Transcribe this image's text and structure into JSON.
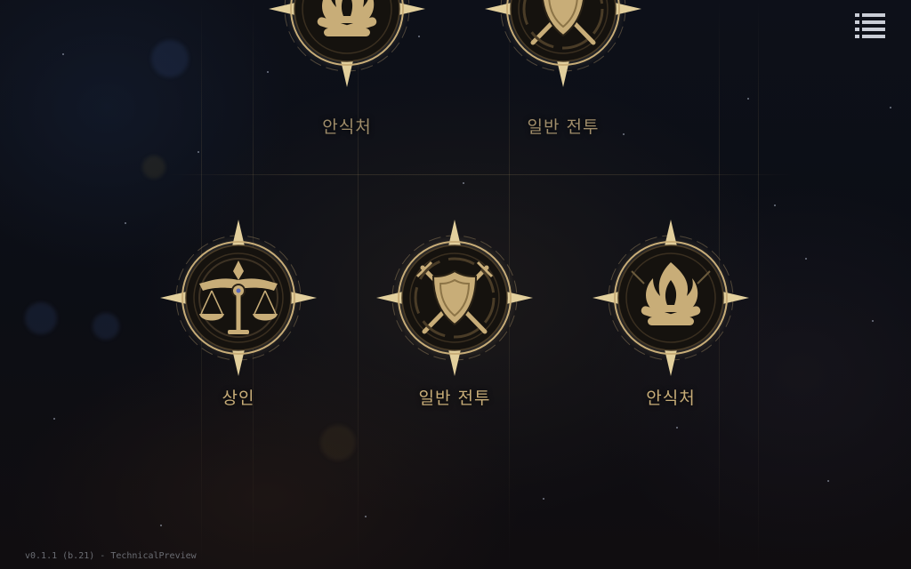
{
  "map": {
    "nodes": [
      {
        "id": "top-rest",
        "label": "안식처",
        "icon": "campfire-icon"
      },
      {
        "id": "top-battle",
        "label": "일반 전투",
        "icon": "crossed-swords-shield-icon"
      },
      {
        "id": "merchant",
        "label": "상인",
        "icon": "scales-icon"
      },
      {
        "id": "battle",
        "label": "일반 전투",
        "icon": "crossed-swords-shield-icon"
      },
      {
        "id": "rest",
        "label": "안식처",
        "icon": "campfire-icon"
      }
    ]
  },
  "menu": {
    "icon": "list-menu-icon"
  },
  "footer": {
    "version": "v0.1.1 (b.21) - TechnicalPreview"
  },
  "colors": {
    "gold": "#c8ad78",
    "gold_bright": "#e2cf9c",
    "disc": "#15120e",
    "background": "#0b0d14"
  }
}
